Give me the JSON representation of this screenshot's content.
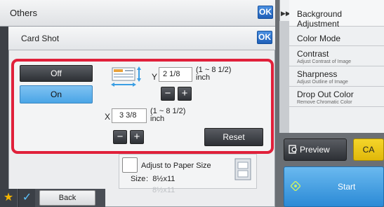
{
  "top_bar": {
    "title": "Others",
    "ok_label": "OK"
  },
  "dialog": {
    "title": "Card Shot",
    "ok_label": "OK",
    "off_label": "Off",
    "on_label": "On",
    "selected": "On",
    "y": {
      "axis": "Y",
      "value": "2 1/8",
      "range": "(1 ~ 8 1/2)",
      "unit": "inch"
    },
    "x": {
      "axis": "X",
      "value": "3 3/8",
      "range": "(1 ~ 8 1/2)",
      "unit": "inch"
    },
    "minus_label": "−",
    "plus_label": "+",
    "reset_label": "Reset",
    "adjust_label": "Adjust to Paper Size",
    "size_label": "Size",
    "size_sep": ":",
    "size_value": "8½x11",
    "faded_text": "8½x11"
  },
  "side_panel": {
    "header": "Background Adjustment",
    "items": [
      {
        "label": "Color Mode",
        "sub": ""
      },
      {
        "label": "Contrast",
        "sub": "Adjust Contrast of Image"
      },
      {
        "label": "Sharpness",
        "sub": "Adjust Outline of Image"
      },
      {
        "label": "Drop Out Color",
        "sub": "Remove Chromatic Color"
      }
    ]
  },
  "actions": {
    "preview_label": "Preview",
    "ca_label": "CA",
    "start_label": "Start",
    "back_label": "Back"
  },
  "colors": {
    "highlight": "#e0203a",
    "selected": "#4aa5e6",
    "start": "#2b8ad6",
    "ca": "#f5d52a"
  }
}
